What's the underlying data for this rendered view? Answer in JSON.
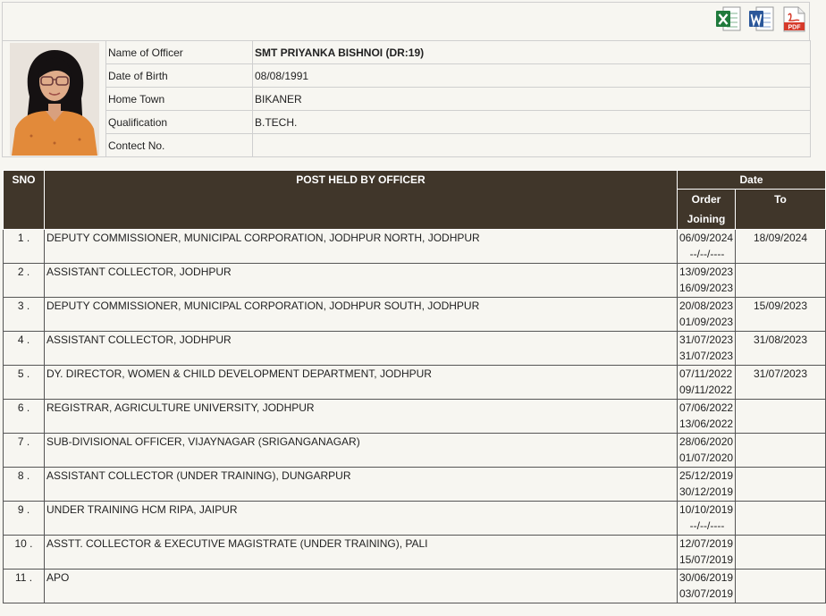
{
  "toolbar": {
    "icons": [
      {
        "name": "excel-icon",
        "color": "#1f7a3c"
      },
      {
        "name": "word-icon",
        "color": "#2b579a"
      },
      {
        "name": "pdf-icon",
        "color": "#d63a2a",
        "text": "PDF"
      }
    ]
  },
  "profile": {
    "fields": [
      {
        "label": "Name of Officer",
        "value": "SMT PRIYANKA BISHNOI (DR:19)"
      },
      {
        "label": "Date of Birth",
        "value": "08/08/1991"
      },
      {
        "label": "Home Town",
        "value": "BIKANER"
      },
      {
        "label": "Qualification",
        "value": "B.TECH."
      },
      {
        "label": "Contect No.",
        "value": ""
      }
    ]
  },
  "posts": {
    "headers": {
      "sno": "SNO",
      "post": "POST HELD BY OFFICER",
      "date": "Date",
      "order": "Order",
      "joining": "Joining",
      "to": "To"
    },
    "rows": [
      {
        "sno": "1 .",
        "post": "DEPUTY COMMISSIONER, MUNICIPAL CORPORATION, JODHPUR NORTH, JODHPUR",
        "order": "06/09/2024",
        "joining": "--/--/----",
        "to": "18/09/2024"
      },
      {
        "sno": "2 .",
        "post": "ASSISTANT COLLECTOR, JODHPUR",
        "order": "13/09/2023",
        "joining": "16/09/2023",
        "to": ""
      },
      {
        "sno": "3 .",
        "post": "DEPUTY COMMISSIONER, MUNICIPAL CORPORATION, JODHPUR SOUTH, JODHPUR",
        "order": "20/08/2023",
        "joining": "01/09/2023",
        "to": "15/09/2023"
      },
      {
        "sno": "4 .",
        "post": "ASSISTANT COLLECTOR, JODHPUR",
        "order": "31/07/2023",
        "joining": "31/07/2023",
        "to": "31/08/2023"
      },
      {
        "sno": "5 .",
        "post": "DY. DIRECTOR, WOMEN & CHILD DEVELOPMENT DEPARTMENT, JODHPUR",
        "order": "07/11/2022",
        "joining": "09/11/2022",
        "to": "31/07/2023"
      },
      {
        "sno": "6 .",
        "post": "REGISTRAR, AGRICULTURE UNIVERSITY, JODHPUR",
        "order": "07/06/2022",
        "joining": "13/06/2022",
        "to": ""
      },
      {
        "sno": "7 .",
        "post": "SUB-DIVISIONAL OFFICER, VIJAYNAGAR (SRIGANGANAGAR)",
        "order": "28/06/2020",
        "joining": "01/07/2020",
        "to": ""
      },
      {
        "sno": "8 .",
        "post": "ASSISTANT COLLECTOR (UNDER TRAINING), DUNGARPUR",
        "order": "25/12/2019",
        "joining": "30/12/2019",
        "to": ""
      },
      {
        "sno": "9 .",
        "post": "UNDER TRAINING HCM RIPA, JAIPUR",
        "order": "10/10/2019",
        "joining": "--/--/----",
        "to": ""
      },
      {
        "sno": "10 .",
        "post": "ASSTT. COLLECTOR & EXECUTIVE MAGISTRATE (UNDER TRAINING), PALI",
        "order": "12/07/2019",
        "joining": "15/07/2019",
        "to": ""
      },
      {
        "sno": "11 .",
        "post": "APO",
        "order": "30/06/2019",
        "joining": "03/07/2019",
        "to": ""
      }
    ]
  }
}
